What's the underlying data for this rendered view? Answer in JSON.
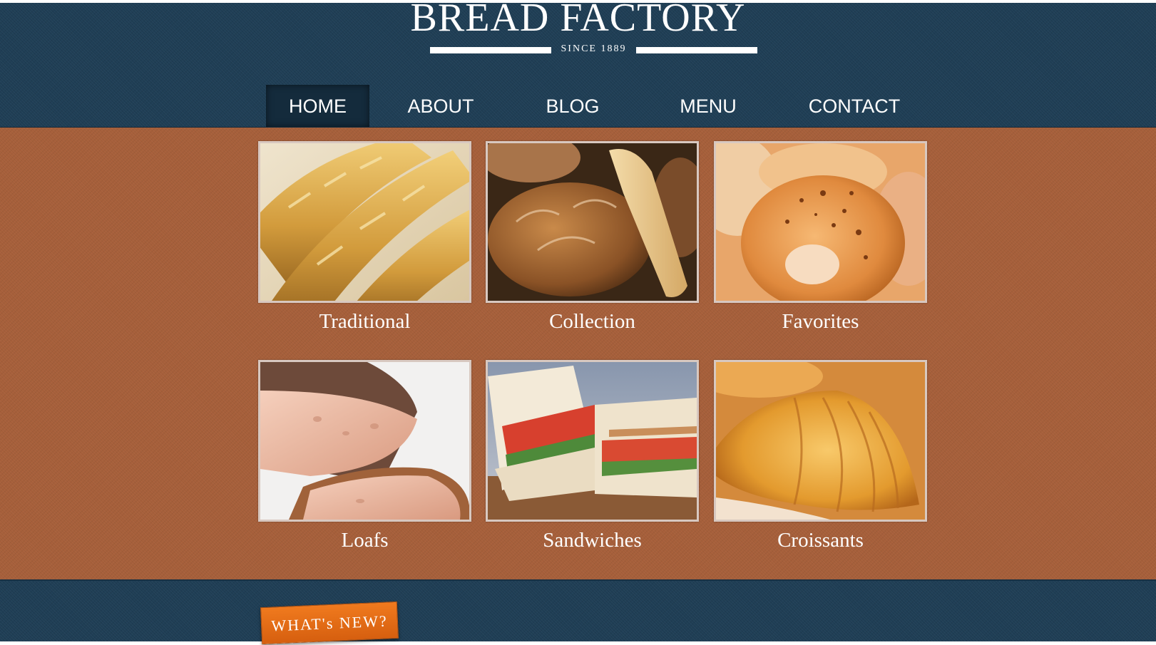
{
  "brand": {
    "title": "BREAD FACTORY",
    "since": "SINCE 1889"
  },
  "nav": {
    "items": [
      {
        "label": "HOME",
        "active": true
      },
      {
        "label": "ABOUT",
        "active": false
      },
      {
        "label": "BLOG",
        "active": false
      },
      {
        "label": "MENU",
        "active": false
      },
      {
        "label": "CONTACT",
        "active": false
      }
    ]
  },
  "gallery": {
    "tiles": [
      {
        "label": "Traditional",
        "image": "baguettes-photo"
      },
      {
        "label": "Collection",
        "image": "bread-loaves-photo"
      },
      {
        "label": "Favorites",
        "image": "bagels-photo"
      },
      {
        "label": "Loafs",
        "image": "sliced-loaf-photo"
      },
      {
        "label": "Sandwiches",
        "image": "sandwich-photo"
      },
      {
        "label": "Croissants",
        "image": "croissant-photo"
      }
    ]
  },
  "footer": {
    "whats_new": "WHAT's NEW?"
  },
  "colors": {
    "header_bg": "#1f3e55",
    "main_bg": "#a65f3a",
    "nav_active_bg": "#142b3c",
    "badge": "#e86f17",
    "text": "#ffffff"
  }
}
